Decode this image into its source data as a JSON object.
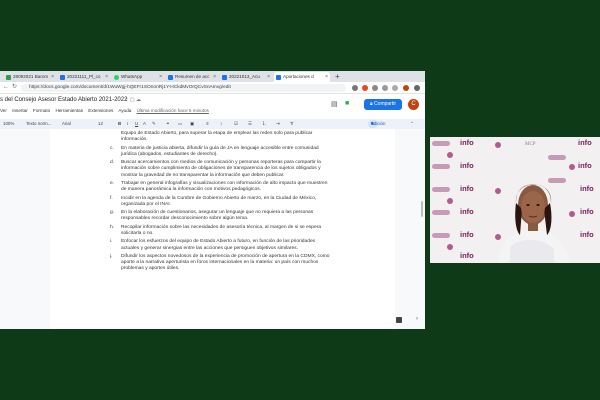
{
  "browser": {
    "tabs": [
      {
        "label": "28092021 Barom",
        "color": "#2e9c4e"
      },
      {
        "label": "20221111_Pl_co",
        "color": "#1a73e8"
      },
      {
        "label": "WhatsApp",
        "color": "#25d366"
      },
      {
        "label": "Resumen de acc",
        "color": "#1a73e8"
      },
      {
        "label": "20221013_Acu",
        "color": "#1a73e8"
      },
      {
        "label": "Aportaciones d",
        "color": "#1a73e8",
        "active": true
      }
    ],
    "url": "https://docs.google.com/document/d/1WuWgj-hQEFr1SOnonRj1Y-HCkdMvOrQCvSnAInvg/edit"
  },
  "doc": {
    "title": "s del Consejo Asesor Estado Abierto 2021-2022",
    "menus": [
      "Ver",
      "Insertar",
      "Formato",
      "Herramientas",
      "Extensiones",
      "Ayuda"
    ],
    "last_edit": "Última modificación hace 5 minutos",
    "share_label": "Compartir",
    "avatar_letter": "C",
    "toolbar": {
      "zoom": "100%",
      "style": "Texto norm...",
      "font": "Arial",
      "size": "12",
      "mode": "Edición"
    },
    "items": [
      {
        "num": "",
        "text": "Equipo de Estado Abierto, para superar la etapa de emplear las redes solo para publicar información."
      },
      {
        "num": "c.",
        "text": "En materia de justicia abierta, difundir la guía de JA en lenguaje accesible entre comunidad jurídica (abogados, estudiantes de derecho)."
      },
      {
        "num": "d.",
        "text": "Buscar acercamientos con medios de comunicación y personas reporteras para compartir la información sobre cumplimiento de obligaciones de transparencia de los sujetos obligados y mostrar la gravedad de no transparentar la información que deben publicar."
      },
      {
        "num": "e.",
        "text": "Trabajar en general infografías y visualizaciones con información de alto impacto que muestren de manera panorámica la información con motivos pedagógicos."
      },
      {
        "num": "f.",
        "text": "Incidir en la agenda de la Cumbre de Gobierno Abierto de marzo, en la Ciudad de México, organizada por el INAI."
      },
      {
        "num": "g.",
        "text": "En la elaboración de cuestionarios, asegurar un lenguaje que no requiera a las personas responsables recordar desconocimiento sobre algún tema."
      },
      {
        "num": "h.",
        "text": "Recopilar información sobre las necesidades de asesoría técnica, al margen de si se espera solicitarla o no."
      },
      {
        "num": "i.",
        "text": "Enfocar los esfuerzos del equipo de Estado Abierto a futuro, en función de las prioridades actuales y generar sinergias entre las acciones que persiguen objetivos similares."
      },
      {
        "num": "j.",
        "text": "Difundir los aspectos novedosos de la experiencia de promoción de apertura en la CDMX, como aporte a la narrativa aperturista en foros internacionales en la materia: un país con muchos problemas y aportes útiles."
      }
    ]
  },
  "video": {
    "logo_text": "info"
  }
}
